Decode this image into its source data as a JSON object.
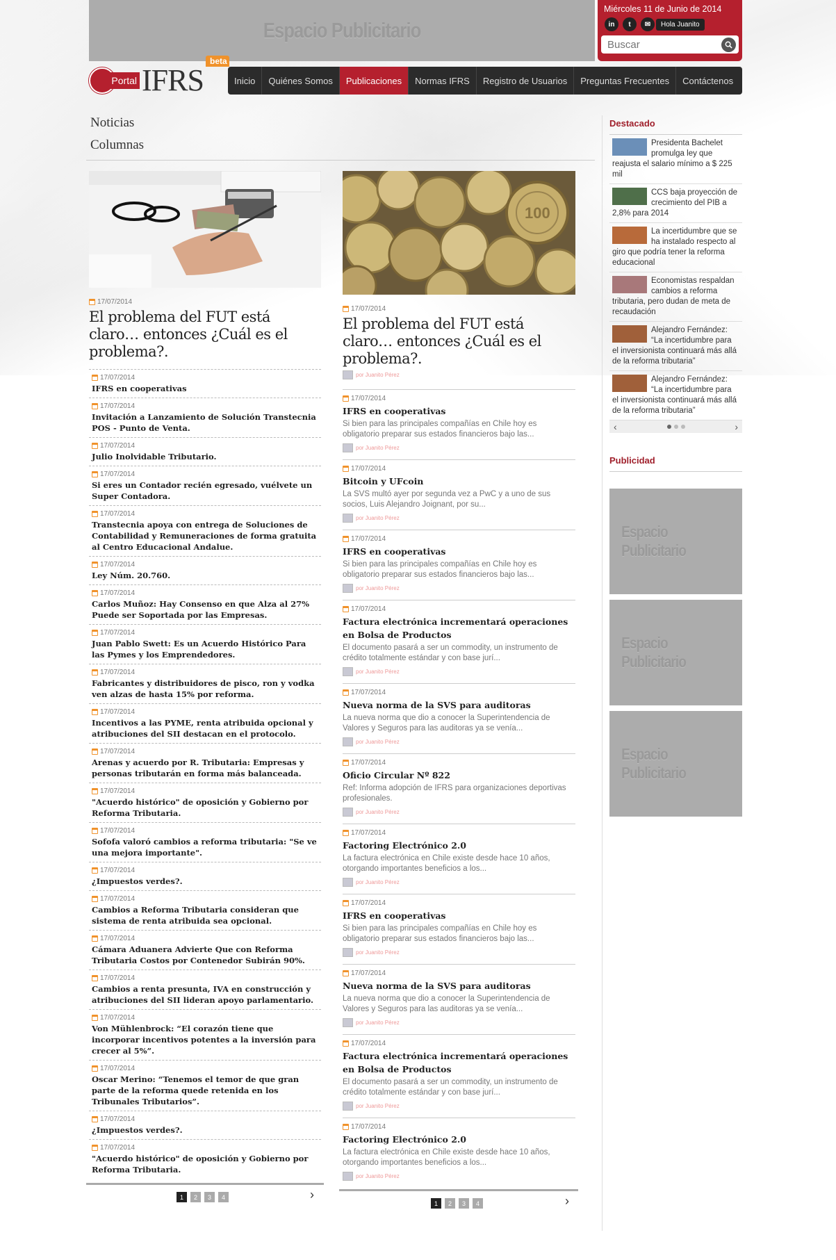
{
  "top_ad": {
    "label": "Espacio Publicitario"
  },
  "header": {
    "date": "Miércoles 11 de Junio de 2014",
    "social": [
      "in",
      "t",
      "✉"
    ],
    "greeting": "Hola Juanito",
    "search_placeholder": "Buscar"
  },
  "logo": {
    "portal": "Portal",
    "ifrs": "IFRS",
    "beta": "beta"
  },
  "nav": [
    "Inicio",
    "Quiénes Somos",
    "Publicaciones",
    "Normas IFRS",
    "Registro de Usuarios",
    "Preguntas Frecuentes",
    "Contáctenos"
  ],
  "tabs": [
    "Noticias",
    "Columnas"
  ],
  "left": {
    "featured": {
      "date": "17/07/2014",
      "title": "El problema del FUT está claro… entonces ¿Cuál es el problema?."
    },
    "items": [
      {
        "date": "17/07/2014",
        "title": "IFRS en cooperativas"
      },
      {
        "date": "17/07/2014",
        "title": "Invitación a Lanzamiento de Solución Transtecnia POS - Punto de Venta."
      },
      {
        "date": "17/07/2014",
        "title": "Julio Inolvidable Tributario."
      },
      {
        "date": "17/07/2014",
        "title": "Si eres un Contador recién egresado, vuélvete un Super Contadora."
      },
      {
        "date": "17/07/2014",
        "title": "Transtecnia apoya con entrega de Soluciones de Contabilidad y Remuneraciones de forma gratuita al Centro Educacional Andalue."
      },
      {
        "date": "17/07/2014",
        "title": "Ley Núm. 20.760."
      },
      {
        "date": "17/07/2014",
        "title": "Carlos Muñoz: Hay Consenso en que Alza al 27% Puede ser Soportada por las Empresas."
      },
      {
        "date": "17/07/2014",
        "title": "Juan Pablo Swett: Es un Acuerdo Histórico Para las Pymes y los Emprendedores."
      },
      {
        "date": "17/07/2014",
        "title": "Fabricantes y distribuidores de pisco, ron y vodka ven alzas de hasta 15% por reforma."
      },
      {
        "date": "17/07/2014",
        "title": "Incentivos a las PYME, renta atribuida opcional y atribuciones del SII destacan en el protocolo."
      },
      {
        "date": "17/07/2014",
        "title": "Arenas y acuerdo por R. Tributaria: Empresas y personas tributarán en forma más balanceada."
      },
      {
        "date": "17/07/2014",
        "title": "\"Acuerdo histórico\" de oposición y Gobierno por Reforma Tributaria."
      },
      {
        "date": "17/07/2014",
        "title": "Sofofa valoró cambios a reforma tributaria: \"Se ve una mejora importante\"."
      },
      {
        "date": "17/07/2014",
        "title": "¿Impuestos verdes?."
      },
      {
        "date": "17/07/2014",
        "title": "Cambios a Reforma Tributaria consideran que sistema de renta atribuida sea opcional."
      },
      {
        "date": "17/07/2014",
        "title": "Cámara Aduanera Advierte Que con Reforma Tributaria Costos por Contenedor Subirán 90%."
      },
      {
        "date": "17/07/2014",
        "title": "Cambios a renta presunta, IVA en construcción y atribuciones del SII lideran apoyo parlamentario."
      },
      {
        "date": "17/07/2014",
        "title": "Von Mühlenbrock: “El corazón tiene que incorporar incentivos potentes a la inversión para crecer al 5%”."
      },
      {
        "date": "17/07/2014",
        "title": "Oscar Merino: “Tenemos el temor de que gran parte de la reforma quede retenida en los Tribunales Tributarios”."
      },
      {
        "date": "17/07/2014",
        "title": "¿Impuestos verdes?."
      },
      {
        "date": "17/07/2014",
        "title": "\"Acuerdo histórico\" de oposición y Gobierno por Reforma Tributaria."
      }
    ],
    "pages": [
      "1",
      "2",
      "3",
      "4"
    ],
    "next": "›"
  },
  "middle": {
    "featured": {
      "date": "17/07/2014",
      "title": "El problema del FUT está claro… entonces ¿Cuál es el problema?.",
      "author": "por Juanito Pérez"
    },
    "items": [
      {
        "date": "17/07/2014",
        "title": "IFRS en cooperativas",
        "summary": "Si bien para las principales compañías en Chile hoy es obligatorio preparar sus estados financieros bajo las...",
        "author": "por Juanito Pérez"
      },
      {
        "date": "17/07/2014",
        "title": "Bitcoin y UFcoin",
        "summary": "La SVS multó ayer por segunda vez a PwC y a uno de sus socios, Luis Alejandro Joignant, por su...",
        "author": "por Juanito Pérez"
      },
      {
        "date": "17/07/2014",
        "title": "IFRS en cooperativas",
        "summary": "Si bien para las principales compañías en Chile hoy es obligatorio preparar sus estados financieros bajo las...",
        "author": "por Juanito Pérez"
      },
      {
        "date": "17/07/2014",
        "title": "Factura electrónica incrementará operaciones en Bolsa de Productos",
        "summary": "El documento pasará a ser un commodity, un instrumento de crédito totalmente estándar y con base jurí...",
        "author": "por Juanito Pérez"
      },
      {
        "date": "17/07/2014",
        "title": "Nueva norma de la SVS para auditoras",
        "summary": "La nueva norma que dio a conocer la Superintendencia de Valores y Seguros para las auditoras ya se venía...",
        "author": "por Juanito Pérez"
      },
      {
        "date": "17/07/2014",
        "title": "Oficio Circular Nº 822",
        "summary": "Ref: Informa adopción de IFRS para organizaciones deportivas profesionales.",
        "author": "por Juanito Pérez"
      },
      {
        "date": "17/07/2014",
        "title": "Factoring Electrónico 2.0",
        "summary": "La factura electrónica en Chile existe desde hace 10 años, otorgando importantes beneficios a los...",
        "author": "por Juanito Pérez"
      },
      {
        "date": "17/07/2014",
        "title": "IFRS en cooperativas",
        "summary": "Si bien para las principales compañías en Chile hoy es obligatorio preparar sus estados financieros bajo las...",
        "author": "por Juanito Pérez"
      },
      {
        "date": "17/07/2014",
        "title": "Nueva norma de la SVS para auditoras",
        "summary": "La nueva norma que dio a conocer la Superintendencia de Valores y Seguros para las auditoras ya se venía...",
        "author": "por Juanito Pérez"
      },
      {
        "date": "17/07/2014",
        "title": "Factura electrónica incrementará operaciones en Bolsa de Productos",
        "summary": "El documento pasará a ser un commodity, un instrumento de crédito totalmente estándar y con base jurí...",
        "author": "por Juanito Pérez"
      },
      {
        "date": "17/07/2014",
        "title": "Factoring Electrónico 2.0",
        "summary": "La factura electrónica en Chile existe desde hace 10 años, otorgando importantes beneficios a los...",
        "author": "por Juanito Pérez"
      }
    ],
    "pages": [
      "1",
      "2",
      "3",
      "4"
    ],
    "next": "›"
  },
  "right": {
    "destacado_title": "Destacado",
    "destacado": [
      "Presidenta Bachelet promulga ley que reajusta el salario mínimo a $ 225 mil",
      "CCS baja proyección de crecimiento del PIB a 2,8% para 2014",
      "La incertidumbre que se ha instalado respecto al giro que podría tener la reforma educacional",
      "Economistas respaldan cambios a reforma tributaria, pero dudan de meta de recaudación",
      "Alejandro Fernández: “La incertidumbre para el inversionista continuará más allá de la reforma tributaria”",
      "Alejandro Fernández: “La incertidumbre para el inversionista continuará más allá de la reforma tributaria”"
    ],
    "prev": "‹",
    "next": "›",
    "publicidad_title": "Publicidad",
    "ads": [
      "Espacio Publicitario",
      "Espacio Publicitario",
      "Espacio Publicitario"
    ]
  }
}
